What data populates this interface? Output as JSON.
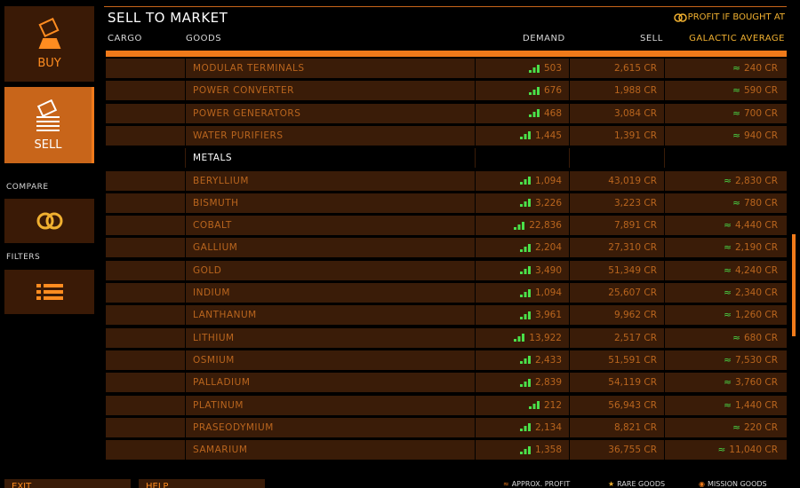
{
  "sidebar": {
    "buy_label": "BUY",
    "sell_label": "SELL",
    "compare_label": "COMPARE",
    "filters_label": "FILTERS"
  },
  "header": {
    "title": "SELL TO MARKET",
    "profit_note": "PROFIT IF BOUGHT AT",
    "columns": {
      "cargo": "CARGO",
      "goods": "GOODS",
      "demand": "DEMAND",
      "sell": "SELL",
      "galactic": "GALACTIC AVERAGE"
    }
  },
  "colors": {
    "accent": "#f07a1a",
    "row_bg": "#3a1c08",
    "text_orange": "#b9651e",
    "green": "#4ae04a",
    "gold": "#f0b030"
  },
  "rows": [
    {
      "type": "item",
      "goods": "MODULAR TERMINALS",
      "demand": "503",
      "sell": "2,615 CR",
      "avg": "240 CR"
    },
    {
      "type": "item",
      "goods": "POWER CONVERTER",
      "demand": "676",
      "sell": "1,988 CR",
      "avg": "590 CR"
    },
    {
      "type": "item",
      "goods": "POWER GENERATORS",
      "demand": "468",
      "sell": "3,084 CR",
      "avg": "700 CR"
    },
    {
      "type": "item",
      "goods": "WATER PURIFIERS",
      "demand": "1,445",
      "sell": "1,391 CR",
      "avg": "940 CR"
    },
    {
      "type": "category",
      "goods": "METALS"
    },
    {
      "type": "item",
      "goods": "BERYLLIUM",
      "demand": "1,094",
      "sell": "43,019 CR",
      "avg": "2,830 CR"
    },
    {
      "type": "item",
      "goods": "BISMUTH",
      "demand": "3,226",
      "sell": "3,223 CR",
      "avg": "780 CR"
    },
    {
      "type": "item",
      "goods": "COBALT",
      "demand": "22,836",
      "sell": "7,891 CR",
      "avg": "4,440 CR"
    },
    {
      "type": "item",
      "goods": "GALLIUM",
      "demand": "2,204",
      "sell": "27,310 CR",
      "avg": "2,190 CR"
    },
    {
      "type": "item",
      "goods": "GOLD",
      "demand": "3,490",
      "sell": "51,349 CR",
      "avg": "4,240 CR"
    },
    {
      "type": "item",
      "goods": "INDIUM",
      "demand": "1,094",
      "sell": "25,607 CR",
      "avg": "2,340 CR"
    },
    {
      "type": "item",
      "goods": "LANTHANUM",
      "demand": "3,961",
      "sell": "9,962 CR",
      "avg": "1,260 CR"
    },
    {
      "type": "item",
      "goods": "LITHIUM",
      "demand": "13,922",
      "sell": "2,517 CR",
      "avg": "680 CR"
    },
    {
      "type": "item",
      "goods": "OSMIUM",
      "demand": "2,433",
      "sell": "51,591 CR",
      "avg": "7,530 CR"
    },
    {
      "type": "item",
      "goods": "PALLADIUM",
      "demand": "2,839",
      "sell": "54,119 CR",
      "avg": "3,760 CR"
    },
    {
      "type": "item",
      "goods": "PLATINUM",
      "demand": "212",
      "sell": "56,943 CR",
      "avg": "1,440 CR"
    },
    {
      "type": "item",
      "goods": "PRASEODYMIUM",
      "demand": "2,134",
      "sell": "8,821 CR",
      "avg": "220 CR"
    },
    {
      "type": "item",
      "goods": "SAMARIUM",
      "demand": "1,358",
      "sell": "36,755 CR",
      "avg": "11,040 CR"
    }
  ],
  "footer": {
    "exit_label": "EXIT",
    "help_label": "HELP",
    "legend_profit": "APPROX. PROFIT",
    "legend_rare": "RARE GOODS",
    "legend_mission": "MISSION GOODS"
  }
}
